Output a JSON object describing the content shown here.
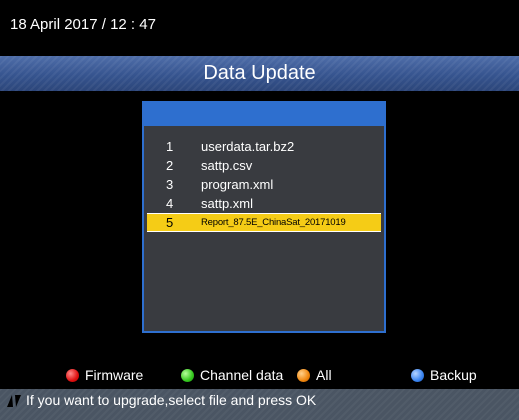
{
  "header": {
    "datetime": "18 April 2017 / 12 : 47",
    "title": "Data Update"
  },
  "file_list": {
    "items": [
      {
        "number": "1",
        "name": "userdata.tar.bz2"
      },
      {
        "number": "2",
        "name": "sattp.csv"
      },
      {
        "number": "3",
        "name": "program.xml"
      },
      {
        "number": "4",
        "name": "sattp.xml"
      },
      {
        "number": "5",
        "name": "Report_87.5E_ChinaSat_20171019"
      }
    ],
    "selected_index": 4
  },
  "color_keys": {
    "red": {
      "label": "Firmware",
      "color": "#e01010",
      "icon": "red-circle-icon"
    },
    "green": {
      "label": "Channel data",
      "color": "#35c81e",
      "icon": "green-circle-icon"
    },
    "orange": {
      "label": "All",
      "color": "#f0860e",
      "icon": "orange-circle-icon"
    },
    "blue": {
      "label": "Backup",
      "color": "#3a84f0",
      "icon": "blue-circle-icon"
    }
  },
  "status": {
    "icon": "up-down-arrows-icon",
    "hint": "If you want to upgrade,select file and press OK"
  },
  "colors": {
    "title_bar": "#36548f",
    "panel_border": "#2e6fcf",
    "selection": "#f5cc16"
  }
}
